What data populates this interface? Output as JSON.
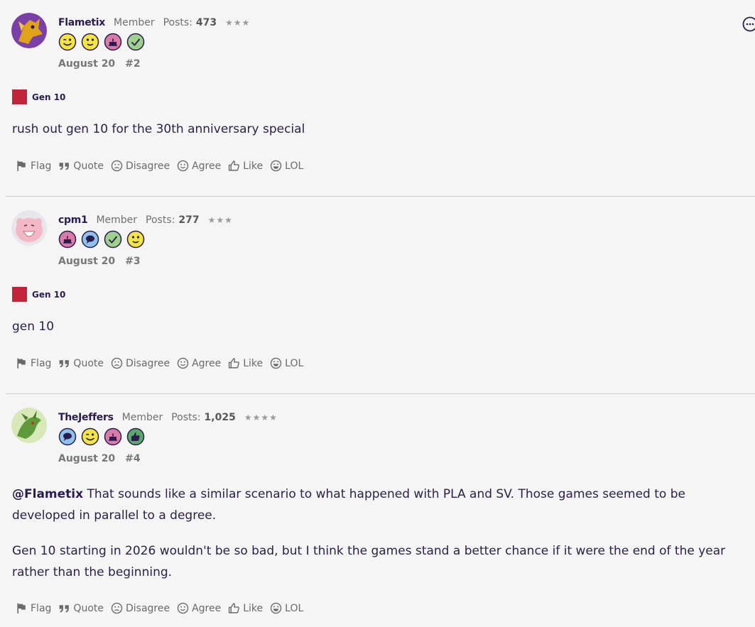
{
  "posts": [
    {
      "username": "Flametix",
      "role": "Member",
      "posts_label": "Posts:",
      "posts_count": "473",
      "stars": "★★★",
      "badges": [
        "wink-badge",
        "smile-badge",
        "cake-badge",
        "check-badge"
      ],
      "date": "August 20",
      "post_number": "#2",
      "tag": "Gen 10",
      "paragraphs": [
        "rush out gen 10 for the 30th anniversary special"
      ]
    },
    {
      "username": "cpm1",
      "role": "Member",
      "posts_label": "Posts:",
      "posts_count": "277",
      "stars": "★★★",
      "badges": [
        "cake-badge",
        "chat-badge",
        "check-badge",
        "smile-badge"
      ],
      "date": "August 20",
      "post_number": "#3",
      "tag": "Gen 10",
      "paragraphs": [
        "gen 10"
      ]
    },
    {
      "username": "TheJeffers",
      "role": "Member",
      "posts_label": "Posts:",
      "posts_count": "1,025",
      "stars": "★★★★",
      "badges": [
        "chat-badge",
        "wink-badge",
        "cake-badge",
        "thumbs-up-badge"
      ],
      "date": "August 20",
      "post_number": "#4",
      "mention": "@Flametix",
      "paragraphs": [
        "That sounds like a similar scenario to what happened with PLA and SV. Those games seemed to be developed in parallel to a degree.",
        "Gen 10 starting in 2026 wouldn't be so bad, but I think the games stand a better chance if it were the end of the year rather than the beginning."
      ]
    }
  ],
  "actions": {
    "flag": "Flag",
    "quote": "Quote",
    "disagree": "Disagree",
    "agree": "Agree",
    "like": "Like",
    "lol": "LOL"
  },
  "colors": {
    "tag": "#c0233a",
    "username": "#2b1c4f",
    "background": "#f5f5f5"
  }
}
